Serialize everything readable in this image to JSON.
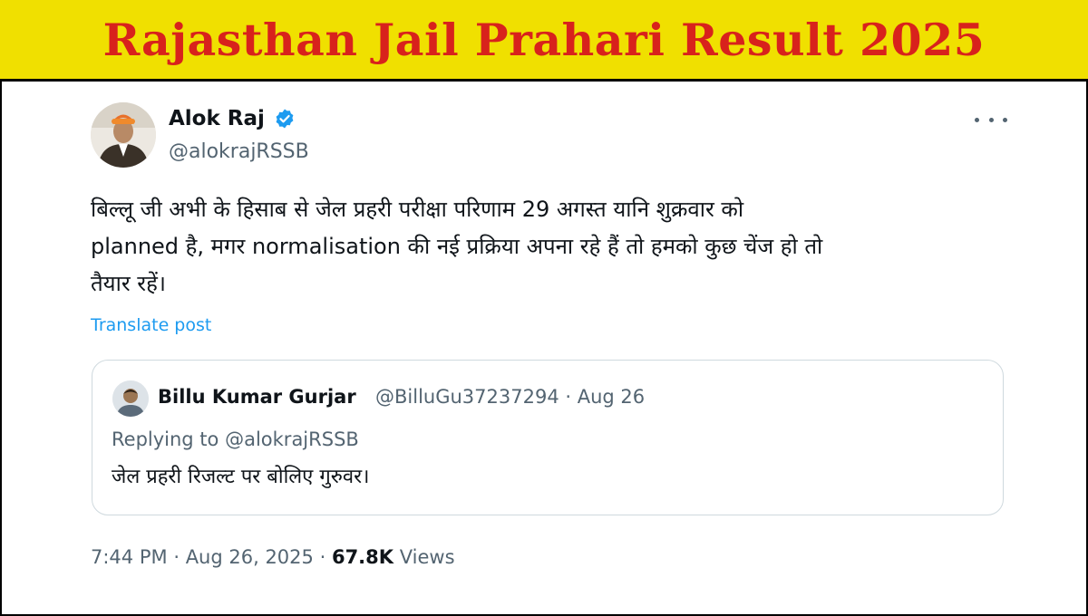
{
  "banner": {
    "title": "Rajasthan Jail Prahari Result 2025"
  },
  "post": {
    "author_name": "Alok Raj",
    "author_handle": "@alokrajRSSB",
    "text_lines": [
      "बिल्लू जी अभी के हिसाब से जेल प्रहरी परीक्षा परिणाम 29 अगस्त यानि शुक्रवार को",
      "planned है, मगर normalisation की नई प्रक्रिया अपना रहे हैं तो हमको कुछ चेंज हो तो",
      "तैयार रहें।"
    ],
    "translate_label": "Translate post",
    "time": "7:44 PM",
    "date": "Aug 26, 2025",
    "views_count": "67.8K",
    "views_label": "Views",
    "separator": "·"
  },
  "quoted": {
    "author_name": "Billu Kumar Gurjar",
    "handle_date": "@BilluGu37237294 · Aug 26",
    "replying_prefix": "Replying to",
    "replying_handle": "@alokrajRSSB",
    "text": "जेल प्रहरी रिजल्ट पर बोलिए गुरुवर।"
  },
  "colors": {
    "banner_bg": "#f0e000",
    "banner_text": "#d8221c",
    "link": "#1d9bf0",
    "muted": "#536471",
    "verified": "#1d9bf0"
  },
  "icons": [
    "verified-badge-icon",
    "more-options-icon"
  ]
}
